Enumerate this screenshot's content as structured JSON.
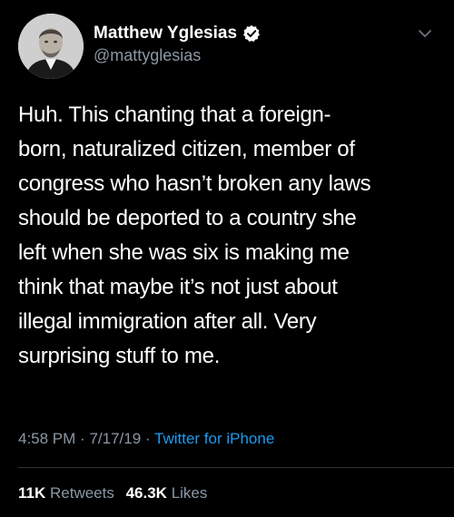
{
  "author": {
    "display_name": "Matthew Yglesias",
    "handle": "@mattyglesias",
    "verified": true
  },
  "tweet": {
    "text": "Huh. This chanting that a foreign-\nborn, naturalized citizen, member of\ncongress who hasn’t broken any laws\nshould be deported to a country she\nleft when she was six is making me\nthink that maybe it’s not just about\nillegal immigration after all. Very\nsurprising stuff to me.",
    "time": "4:58 PM",
    "date": "7/17/19",
    "separator": "·",
    "source": "Twitter for iPhone"
  },
  "stats": {
    "retweets_count": "11K",
    "retweets_label": "Retweets",
    "likes_count": "46.3K",
    "likes_label": "Likes"
  },
  "icons": {
    "verified": "verified-badge-icon",
    "menu": "chevron-down-icon"
  },
  "colors": {
    "background": "#000000",
    "text": "#ffffff",
    "secondary": "#8b98a5",
    "link": "#1d9bf0"
  }
}
